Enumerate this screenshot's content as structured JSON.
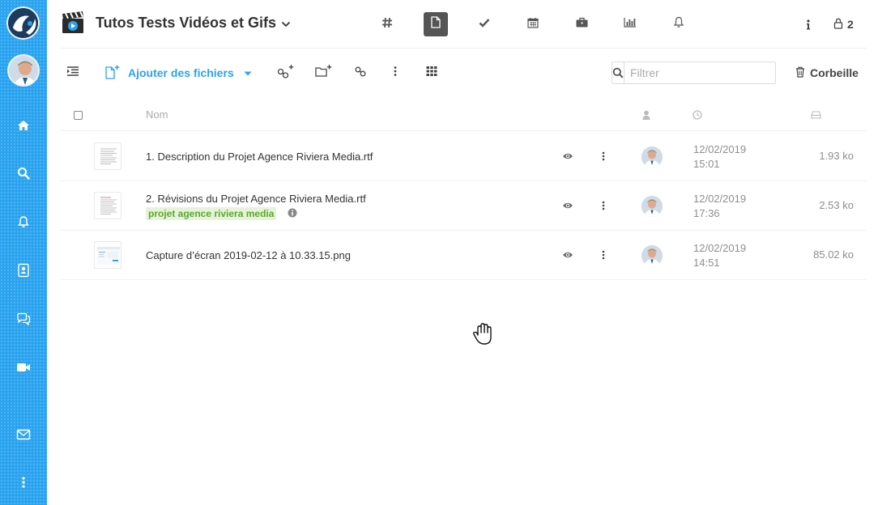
{
  "app": {
    "title": "Tutos Tests Vidéos et Gifs",
    "member_count": "2"
  },
  "colors": {
    "accent": "#2aa3ef",
    "sidebar": "#2aa3ef",
    "tag_text": "#5aa82e",
    "tag_bg": "#e6f3d9",
    "active_tab": "#555555"
  },
  "sidebar": {
    "items": [
      {
        "icon": "home-icon"
      },
      {
        "icon": "search-icon"
      },
      {
        "icon": "bell-icon"
      },
      {
        "icon": "contacts-icon"
      },
      {
        "icon": "chat-icon"
      },
      {
        "icon": "video-icon"
      },
      {
        "icon": "mail-icon"
      },
      {
        "icon": "more-vertical-icon"
      }
    ]
  },
  "header": {
    "tabs": [
      {
        "icon": "hash-icon",
        "active": false
      },
      {
        "icon": "file-icon",
        "active": true
      },
      {
        "icon": "check-icon",
        "active": false
      },
      {
        "icon": "calendar-icon",
        "active": false
      },
      {
        "icon": "briefcase-icon",
        "active": false
      },
      {
        "icon": "bar-chart-icon",
        "active": false
      },
      {
        "icon": "bell-icon",
        "active": false
      }
    ]
  },
  "toolbar": {
    "add_files_label": "Ajouter des fichiers",
    "filter_placeholder": "Filtrer",
    "trash_label": "Corbeille"
  },
  "table": {
    "name_header": "Nom",
    "rows": [
      {
        "name": "1. Description du Projet Agence Riviera Media.rtf",
        "tag": "",
        "date": "12/02/2019",
        "time": "15:01",
        "size": "1.93 ko"
      },
      {
        "name": "2. Révisions du Projet Agence Riviera Media.rtf",
        "tag": "projet agence riviera media",
        "date": "12/02/2019",
        "time": "17:36",
        "size": "2.53 ko"
      },
      {
        "name": "Capture d’écran 2019-02-12 à 10.33.15.png",
        "tag": "",
        "date": "12/02/2019",
        "time": "14:51",
        "size": "85.02 ko"
      }
    ]
  }
}
